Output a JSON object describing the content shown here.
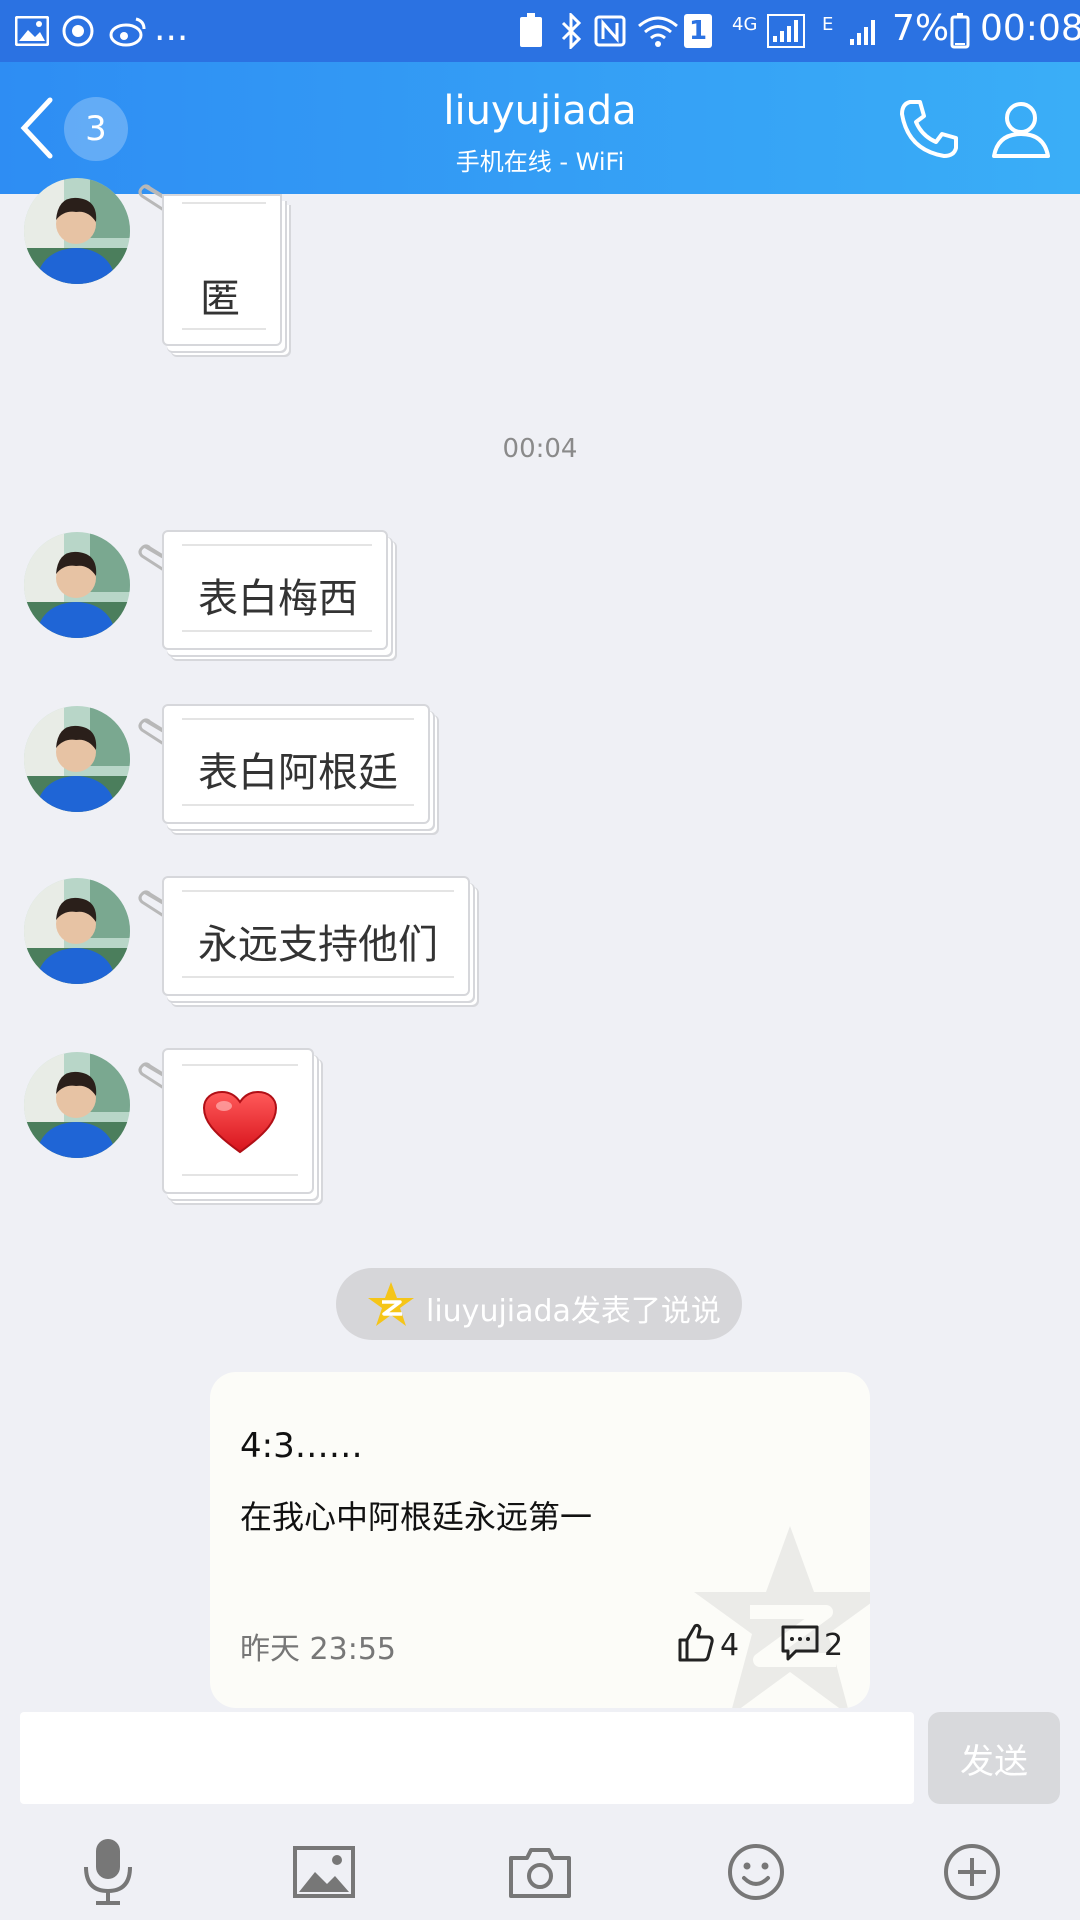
{
  "status_bar": {
    "overflow": "...",
    "sim_slot": "1",
    "network_4g": "4G",
    "network_e": "E",
    "battery": "7%",
    "time": "00:08"
  },
  "header": {
    "unread_count": "3",
    "contact_name": "liuyujiada",
    "contact_status": "手机在线 - WiFi",
    "icons": [
      "back-icon",
      "phone-icon",
      "profile-icon"
    ]
  },
  "messages": [
    {
      "type": "text",
      "text": "匿"
    },
    {
      "type": "time",
      "text": "00:04"
    },
    {
      "type": "text",
      "text": "表白梅西"
    },
    {
      "type": "text",
      "text": "表白阿根廷"
    },
    {
      "type": "text",
      "text": "永远支持他们"
    },
    {
      "type": "emoji",
      "icon": "heart-icon"
    }
  ],
  "qzone_notice": {
    "text": "liuyujiada发表了说说",
    "icon": "qzone-star-icon"
  },
  "post_card": {
    "line1": "4:3……",
    "line2": "在我心中阿根廷永远第一",
    "time": "昨天 23:55",
    "likes": "4",
    "comments": "2"
  },
  "composer": {
    "placeholder": "",
    "send_label": "发送"
  },
  "toolbar": [
    "voice-icon",
    "image-icon",
    "camera-icon",
    "emoji-icon",
    "add-icon"
  ],
  "colors": {
    "header_start": "#2e8df3",
    "header_end": "#3aaef7",
    "chat_bg": "#eff0f5",
    "heart": "#e8262c"
  }
}
